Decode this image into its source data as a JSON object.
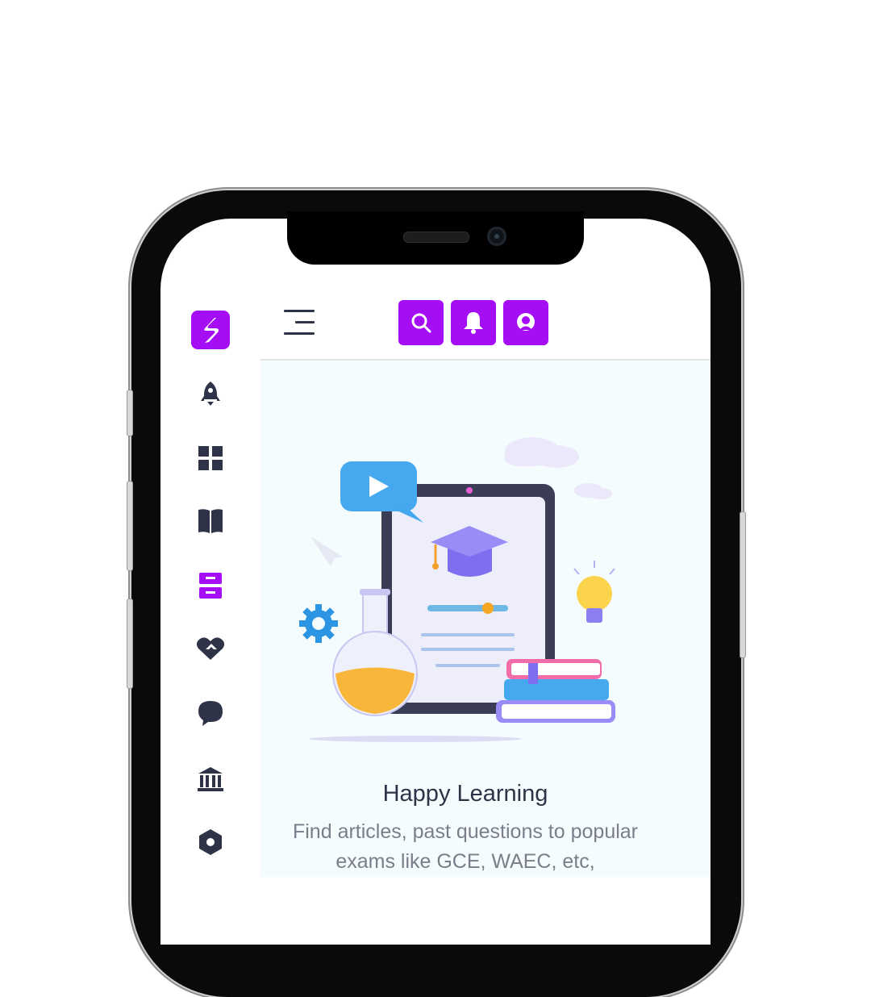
{
  "app": {
    "logo_icon": "brand-s-logo",
    "brand_color": "#a50df5",
    "dark_icon_color": "#2f3348"
  },
  "header": {
    "menu_icon": "menu-icon",
    "buttons": [
      {
        "icon": "search-icon"
      },
      {
        "icon": "bell-icon"
      },
      {
        "icon": "profile-icon"
      }
    ]
  },
  "sidebar": {
    "items": [
      {
        "icon": "rocket-icon",
        "active": false
      },
      {
        "icon": "grid-icon",
        "active": false
      },
      {
        "icon": "book-icon",
        "active": false
      },
      {
        "icon": "archive-icon",
        "active": true
      },
      {
        "icon": "handshake-icon",
        "active": false
      },
      {
        "icon": "chat-icon",
        "active": false
      },
      {
        "icon": "institution-icon",
        "active": false
      },
      {
        "icon": "settings-hex-icon",
        "active": false
      }
    ]
  },
  "hero": {
    "title": "Happy Learning",
    "description": "Find articles, past questions to popular exams like GCE, WAEC, etc,",
    "illustration": "e-learning-tablet-illustration"
  }
}
